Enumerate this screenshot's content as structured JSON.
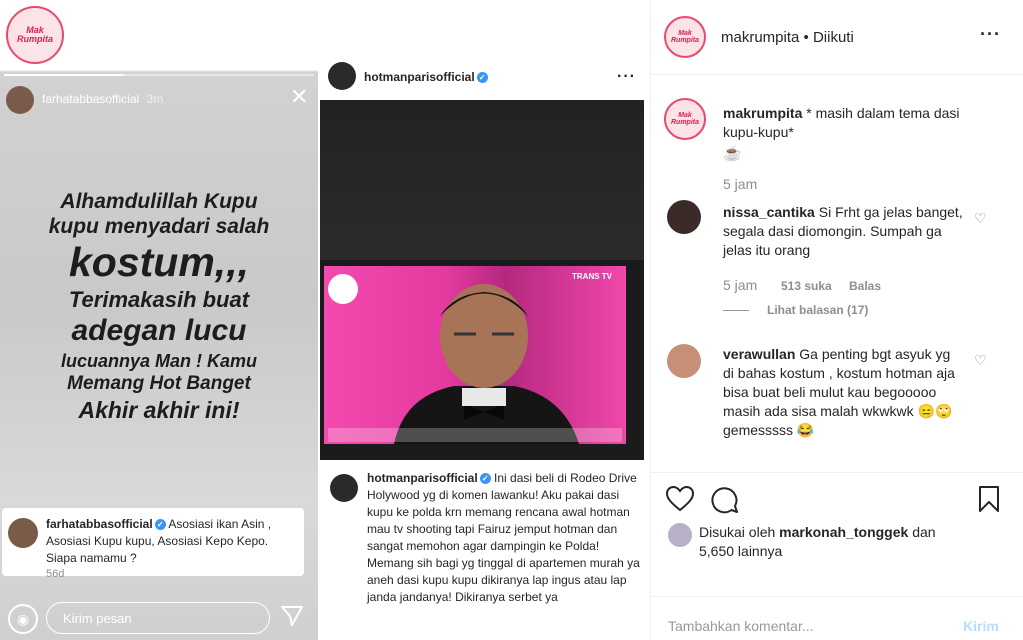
{
  "left_logo": {
    "text": "Mak Rumpita"
  },
  "story": {
    "username": "farhatabbasofficial",
    "time": "3m",
    "lines": [
      "Alhamdulillah Kupu",
      "kupu menyadari salah",
      "kostum,,,",
      "Terimakasih buat",
      "adegan lucu",
      "lucuannya Man ! Kamu",
      "Memang Hot Banget",
      "Akhir akhir ini!"
    ],
    "comment_user": "farhatabbasofficial",
    "comment_text": "Asosiasi ikan Asin , Asosiasi Kupu kupu, Asosiasi Kepo Kepo. Siapa namamu ?",
    "comment_time": "56d",
    "reply_placeholder": "Kirim pesan"
  },
  "post": {
    "username": "hotmanparisofficial",
    "tv_logo": "TRANS TV",
    "caption_user": "hotmanparisofficial",
    "caption_text": "Ini dasi beli di Rodeo Drive Holywood yg di komen lawanku! Aku pakai dasi kupu ke polda krn memang rencana awal hotman mau tv shooting tapi Fairuz jemput hotman dan sangat memohon agar dampingin ke Polda! Memang sih bagi yg tinggal di apartemen murah ya aneh dasi kupu kupu dikiranya lap ingus atau lap janda jandanya! Dikiranya serbet ya"
  },
  "right": {
    "header_user": "makrumpita",
    "header_follow": "• Diikuti",
    "caption_user": "makrumpita",
    "caption_text": "* masih dalam tema dasi kupu-kupu*",
    "caption_time": "5 jam",
    "comments": [
      {
        "user": "nissa_cantika",
        "text": "Si Frht ga jelas banget, segala dasi diomongin. Sumpah ga jelas itu orang",
        "time": "5 jam",
        "likes": "513 suka",
        "reply": "Balas",
        "view_replies": "Lihat balasan (17)"
      },
      {
        "user": "verawullan",
        "text": "Ga penting bgt asyuk yg di bahas kostum , kostum hotman aja bisa buat beli mulut kau begooooo masih ada sisa malah wkwkwk 😑🙄 gemesssss 😂"
      }
    ],
    "liked_prefix": "Disukai oleh",
    "liked_user": "markonah_tonggek",
    "liked_suffix": "dan",
    "liked_count": "5,650 lainnya",
    "add_comment_placeholder": "Tambahkan komentar...",
    "post_button": "Kirim"
  }
}
